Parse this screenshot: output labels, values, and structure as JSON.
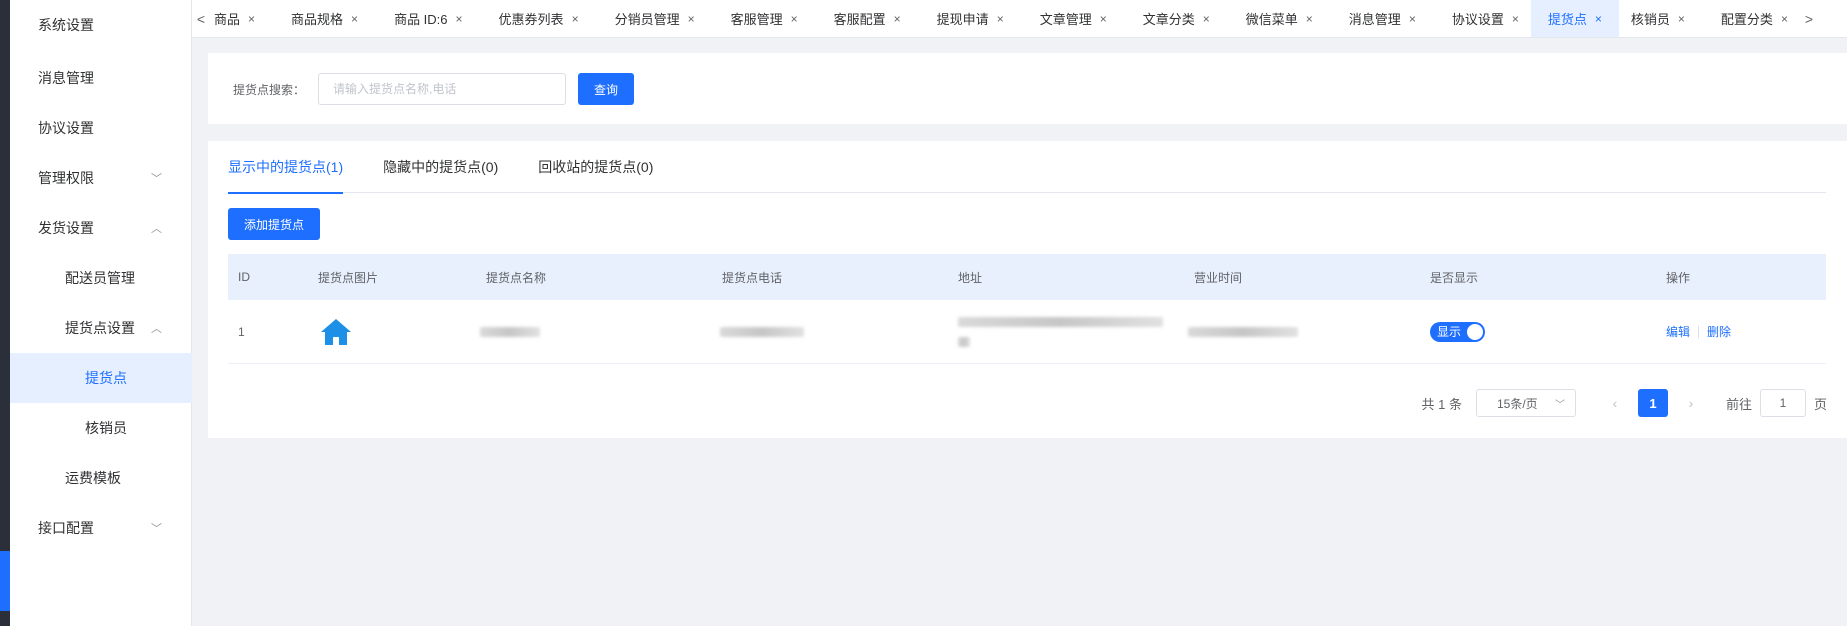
{
  "sidebar": {
    "items": [
      {
        "label": "系统设置",
        "arrow": ""
      },
      {
        "label": "消息管理",
        "arrow": ""
      },
      {
        "label": "协议设置",
        "arrow": ""
      },
      {
        "label": "管理权限",
        "arrow": "﹀"
      },
      {
        "label": "发货设置",
        "arrow": "︿"
      },
      {
        "label": "配送员管理",
        "arrow": ""
      },
      {
        "label": "提货点设置",
        "arrow": "︿"
      },
      {
        "label": "提货点",
        "arrow": ""
      },
      {
        "label": "核销员",
        "arrow": ""
      },
      {
        "label": "运费模板",
        "arrow": ""
      },
      {
        "label": "接口配置",
        "arrow": "﹀"
      }
    ]
  },
  "tabs": {
    "prev": "<",
    "next": ">",
    "items": [
      {
        "label": "商品"
      },
      {
        "label": "商品规格"
      },
      {
        "label": "商品 ID:6"
      },
      {
        "label": "优惠券列表"
      },
      {
        "label": "分销员管理"
      },
      {
        "label": "客服管理"
      },
      {
        "label": "客服配置"
      },
      {
        "label": "提现申请"
      },
      {
        "label": "文章管理"
      },
      {
        "label": "文章分类"
      },
      {
        "label": "微信菜单"
      },
      {
        "label": "消息管理"
      },
      {
        "label": "协议设置"
      },
      {
        "label": "提货点"
      },
      {
        "label": "核销员"
      },
      {
        "label": "配置分类"
      }
    ],
    "close_glyph": "×"
  },
  "search": {
    "label": "提货点搜索：",
    "placeholder": "请输入提货点名称,电话",
    "button": "查询"
  },
  "page_tabs": [
    {
      "label": "显示中的提货点(1)"
    },
    {
      "label": "隐藏中的提货点(0)"
    },
    {
      "label": "回收站的提货点(0)"
    }
  ],
  "add_button": "添加提货点",
  "table": {
    "columns": [
      "ID",
      "提货点图片",
      "提货点名称",
      "提货点电话",
      "地址",
      "营业时间",
      "是否显示",
      "操作"
    ],
    "rows": [
      {
        "id": "1",
        "image_icon": "house-icon",
        "switch_label": "显示",
        "edit": "编辑",
        "delete": "删除"
      }
    ]
  },
  "pagination": {
    "total": "共 1 条",
    "page_size": "15条/页",
    "current": "1",
    "goto_label": "前往",
    "goto_value": "1",
    "goto_suffix": "页"
  },
  "colors": {
    "accent": "#1e6fff",
    "active_bg": "#e6efff",
    "header_bg": "#e8f0fe"
  }
}
